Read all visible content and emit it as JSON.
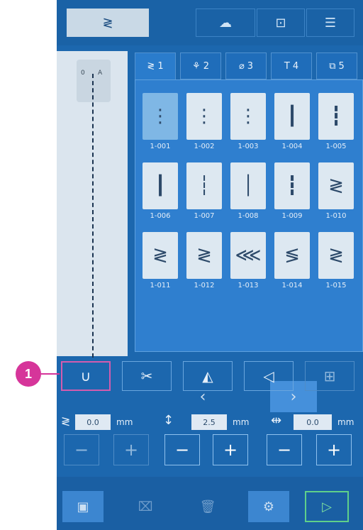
{
  "topbar": {
    "tabs": [
      {
        "name": "stitch-tab",
        "icon": "zigzag-icon",
        "glyph": "≷",
        "active": true
      },
      {
        "name": "cloud-tab",
        "icon": "cloud-icon",
        "glyph": "☁",
        "active": false
      },
      {
        "name": "embroidery-tab",
        "icon": "square-icon",
        "glyph": "⊡",
        "active": false
      },
      {
        "name": "menu-tab",
        "icon": "menu-icon",
        "glyph": "☰",
        "active": false
      }
    ]
  },
  "preview": {
    "foot_labels": [
      "0",
      "A"
    ]
  },
  "categories": [
    {
      "glyph": "≷",
      "num": "1",
      "icon": "zigzag-stitch-icon",
      "active": true
    },
    {
      "glyph": "⚘",
      "num": "2",
      "icon": "decorative-stitch-icon",
      "active": false
    },
    {
      "glyph": "⌀",
      "num": "3",
      "icon": "buttonhole-icon",
      "active": false
    },
    {
      "glyph": "T",
      "num": "4",
      "icon": "letter-icon",
      "active": false
    },
    {
      "glyph": "⧉",
      "num": "5",
      "icon": "my-design-icon",
      "active": false
    }
  ],
  "stitches": [
    {
      "code": "1-001",
      "glyph": "⋮",
      "selected": true
    },
    {
      "code": "1-002",
      "glyph": "⋮",
      "selected": false
    },
    {
      "code": "1-003",
      "glyph": "⋮",
      "selected": false
    },
    {
      "code": "1-004",
      "glyph": "┃",
      "selected": false
    },
    {
      "code": "1-005",
      "glyph": "┇",
      "selected": false
    },
    {
      "code": "1-006",
      "glyph": "┃",
      "selected": false
    },
    {
      "code": "1-007",
      "glyph": "┆",
      "selected": false
    },
    {
      "code": "1-008",
      "glyph": "│",
      "selected": false
    },
    {
      "code": "1-009",
      "glyph": "┇",
      "selected": false
    },
    {
      "code": "1-010",
      "glyph": "≷",
      "selected": false
    },
    {
      "code": "1-011",
      "glyph": "≷",
      "selected": false
    },
    {
      "code": "1-012",
      "glyph": "≷",
      "selected": false
    },
    {
      "code": "1-013",
      "glyph": "⋘",
      "selected": false
    },
    {
      "code": "1-014",
      "glyph": "≶",
      "selected": false
    },
    {
      "code": "1-015",
      "glyph": "≷",
      "selected": false
    }
  ],
  "pager": {
    "prev": "‹",
    "next": "›"
  },
  "tools": [
    {
      "name": "needle-position",
      "glyph": "∪",
      "highlight": true
    },
    {
      "name": "scissors",
      "glyph": "✂",
      "highlight": false
    },
    {
      "name": "mirror",
      "glyph": "◭",
      "highlight": false
    },
    {
      "name": "reverse",
      "glyph": "◁",
      "highlight": false
    },
    {
      "name": "grid",
      "glyph": "⊞",
      "highlight": false
    }
  ],
  "params": {
    "width": {
      "icon": "≷",
      "value": "0.0",
      "unit": "mm"
    },
    "length": {
      "icon": "↕",
      "value": "2.5",
      "unit": "mm"
    },
    "position": {
      "icon": "⇹",
      "value": "0.0",
      "unit": "mm"
    }
  },
  "stepper": {
    "minus": "−",
    "plus": "+"
  },
  "bottom": [
    {
      "name": "save",
      "glyph": "▣"
    },
    {
      "name": "close-file",
      "glyph": "⌧"
    },
    {
      "name": "delete",
      "glyph": "🗑"
    },
    {
      "name": "settings",
      "glyph": "⚙"
    },
    {
      "name": "start",
      "glyph": "▷"
    }
  ],
  "callout": {
    "label": "1"
  },
  "colors": {
    "screen": "#1c67ae",
    "panel": "#2f7fcf",
    "highlight": "#d35cae",
    "marker": "#d6359a"
  }
}
